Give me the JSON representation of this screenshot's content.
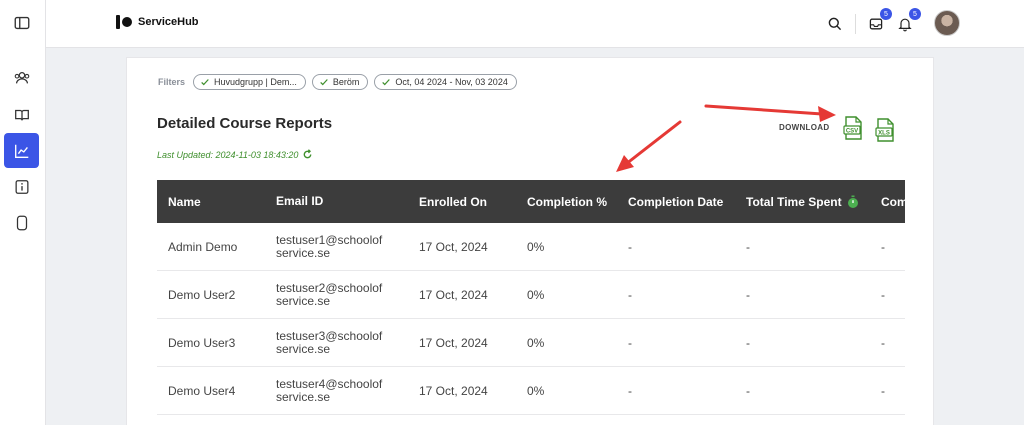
{
  "app": {
    "brand_name": "ServiceHub"
  },
  "topbar": {
    "inbox_badge": "5",
    "notifications_badge": "5"
  },
  "filters": {
    "label": "Filters",
    "chips": [
      "Huvudgrupp | Dem...",
      "Beröm",
      "Oct, 04 2024 - Nov, 03 2024"
    ]
  },
  "report": {
    "title": "Detailed Course Reports",
    "last_updated": "Last Updated: 2024-11-03 18:43:20",
    "download_label": "DOWNLOAD",
    "csv_label": "CSV",
    "xls_label": "XLS"
  },
  "table": {
    "columns": [
      "Name",
      "Email ID",
      "Enrolled On",
      "Completion %",
      "Completion Date",
      "Total Time Spent",
      "Com"
    ],
    "rows": [
      [
        "Admin Demo",
        "testuser1@schoolofservice.se",
        "17 Oct, 2024",
        "0%",
        "-",
        "-",
        "-"
      ],
      [
        "Demo User2",
        "testuser2@schoolofservice.se",
        "17 Oct, 2024",
        "0%",
        "-",
        "-",
        "-"
      ],
      [
        "Demo User3",
        "testuser3@schoolofservice.se",
        "17 Oct, 2024",
        "0%",
        "-",
        "-",
        "-"
      ],
      [
        "Demo User4",
        "testuser4@schoolofservice.se",
        "17 Oct, 2024",
        "0%",
        "-",
        "-",
        "-"
      ]
    ]
  },
  "colors": {
    "accent": "#3b55e6",
    "green": "#3f8f2d",
    "header_bg": "#3c3c3c",
    "arrow": "#e53935"
  }
}
